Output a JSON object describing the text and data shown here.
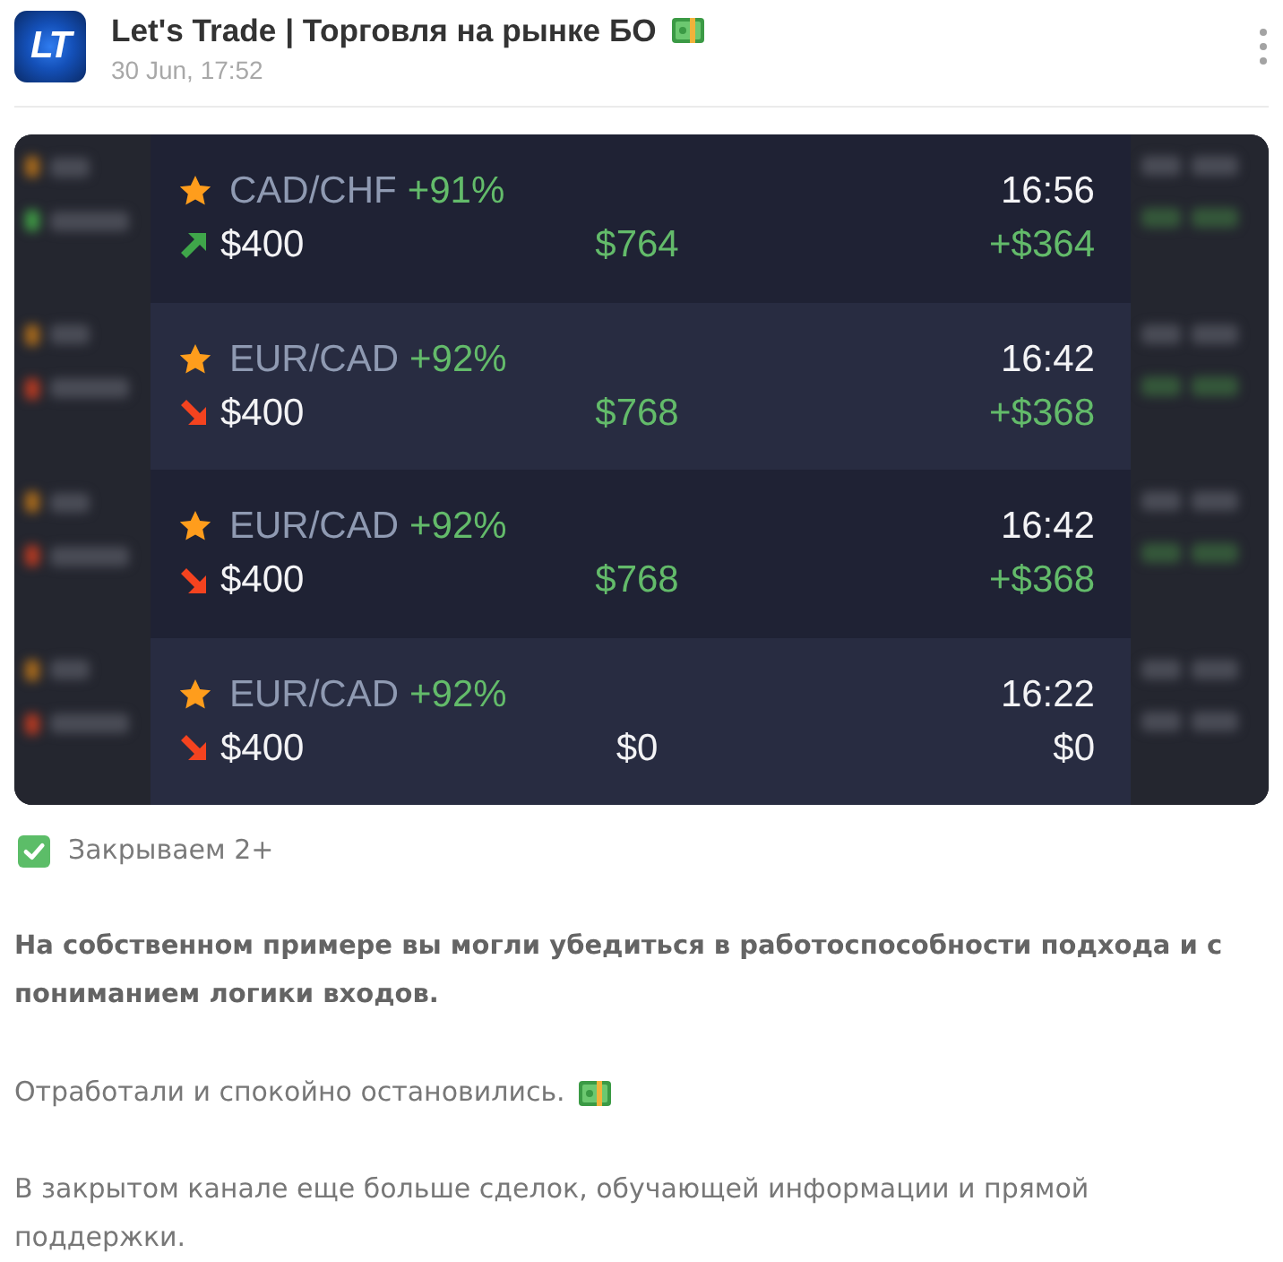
{
  "post": {
    "avatar_text": "LT",
    "title": "Let's Trade | Торговля на рынке БО",
    "date": "30 Jun, 17:52"
  },
  "trades": [
    {
      "pair": "CAD/CHF",
      "percent": "+91%",
      "time": "16:56",
      "kind": "up",
      "amount": "$400",
      "payout": "$764",
      "profit": "+$364",
      "won": true
    },
    {
      "pair": "EUR/CAD",
      "percent": "+92%",
      "time": "16:42",
      "kind": "down",
      "amount": "$400",
      "payout": "$768",
      "profit": "+$368",
      "won": true
    },
    {
      "pair": "EUR/CAD",
      "percent": "+92%",
      "time": "16:42",
      "kind": "down",
      "amount": "$400",
      "payout": "$768",
      "profit": "+$368",
      "won": true
    },
    {
      "pair": "EUR/CAD",
      "percent": "+92%",
      "time": "16:22",
      "kind": "down",
      "amount": "$400",
      "payout": "$0",
      "profit": "$0",
      "won": false
    }
  ],
  "status_line": "Закрываем 2+",
  "paragraphs": [
    {
      "kind": "bold",
      "text": "На собственном примере вы могли убедиться в работоспособности подхода и с пониманием логики входов."
    },
    {
      "kind": "emoji",
      "text": "Отработали и спокойно остановились."
    },
    {
      "kind": "plain",
      "text": "В закрытом канале еще больше сделок, обучающей информации и прямой поддержки."
    }
  ]
}
